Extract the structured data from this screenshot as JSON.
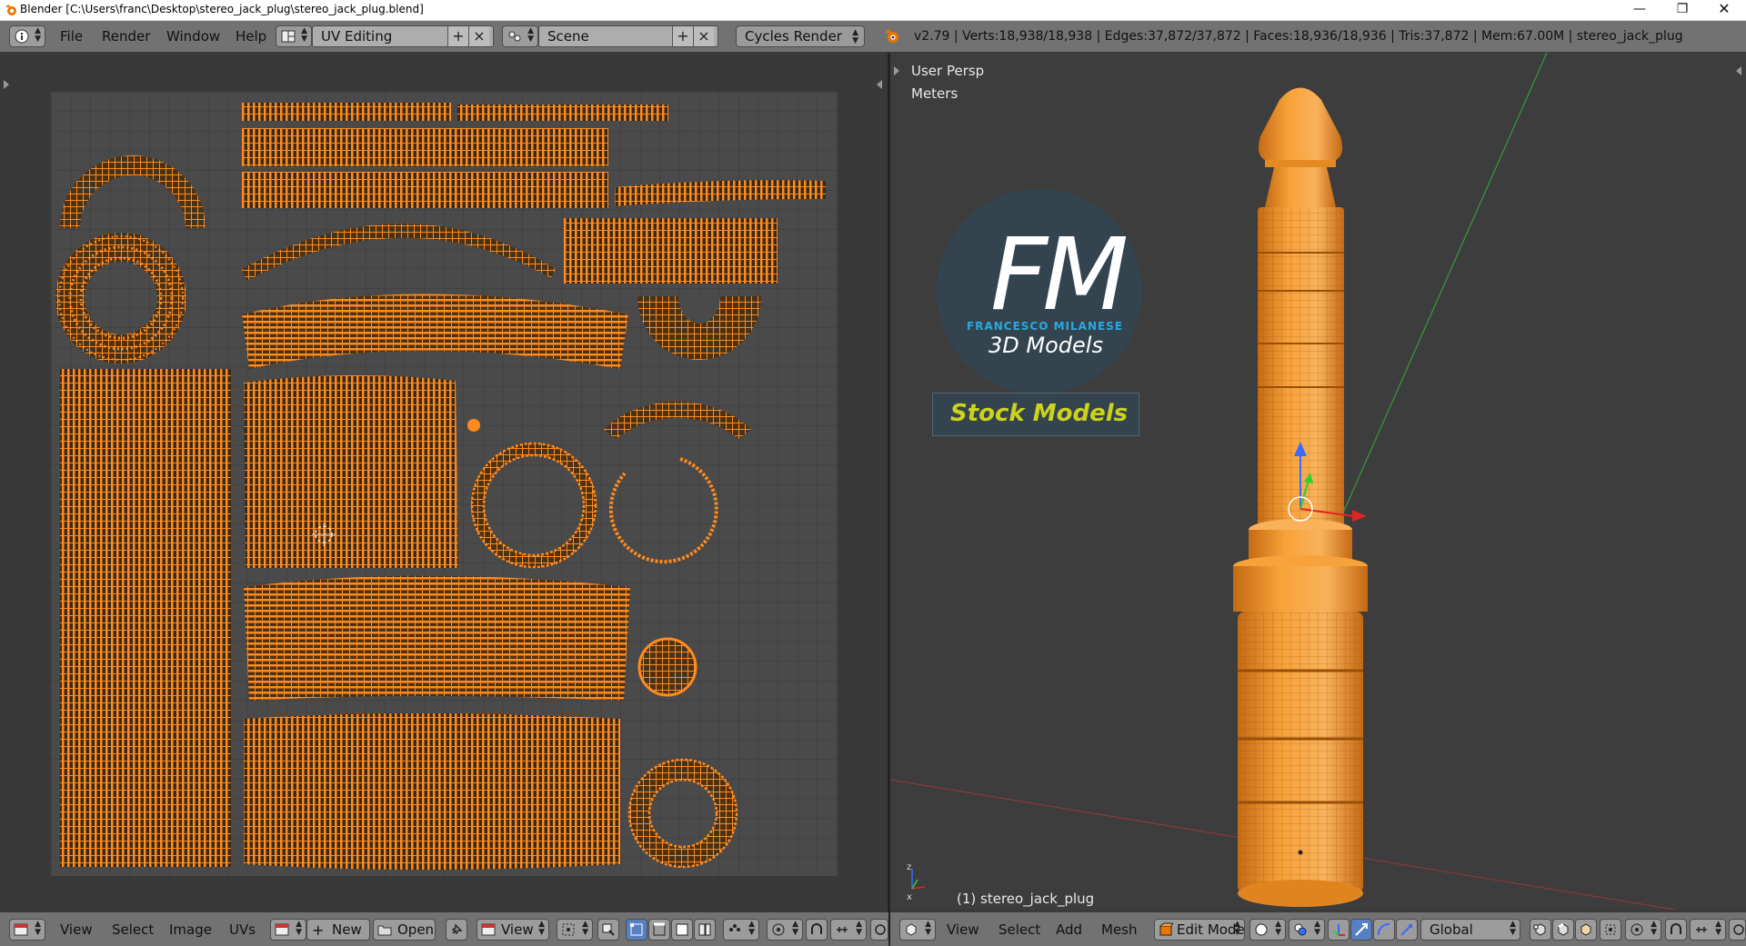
{
  "window": {
    "title": "Blender [C:\\Users\\franc\\Desktop\\stereo_jack_plug\\stereo_jack_plug.blend]",
    "minimize_icon": "minimize-icon",
    "restore_icon": "restore-icon",
    "close_icon": "close-icon"
  },
  "info_header": {
    "menus": [
      "File",
      "Render",
      "Window",
      "Help"
    ],
    "screen_layout": "UV Editing",
    "scene": "Scene",
    "render_engine": "Cycles Render",
    "stats": "v2.79 | Verts:18,938/18,938 | Edges:37,872/37,872 | Faces:18,936/18,936 | Tris:37,872 | Mem:67.00M | stereo_jack_plug"
  },
  "uv_editor": {
    "menus": [
      "View",
      "Select",
      "Image",
      "UVs"
    ],
    "new_label": "New",
    "open_label": "Open",
    "view_label": "View"
  },
  "viewport": {
    "view_label": "User Persp",
    "units_label": "Meters",
    "object_label": "(1) stereo_jack_plug",
    "menus": [
      "View",
      "Select",
      "Add",
      "Mesh"
    ],
    "mode": "Edit Mode",
    "orientation": "Global"
  },
  "watermark": {
    "letters": "FM",
    "name": "FRANCESCO MILANESE",
    "sub": "3D Models",
    "stock": "Stock Models"
  },
  "colors": {
    "uv_orange": "#ff8a1e",
    "selected_mesh": "#f7a23a",
    "header_gray": "#727272",
    "editor_bg": "#393939",
    "fm_cyan": "#29a9e0",
    "stock_yellow": "#cdd21b"
  }
}
